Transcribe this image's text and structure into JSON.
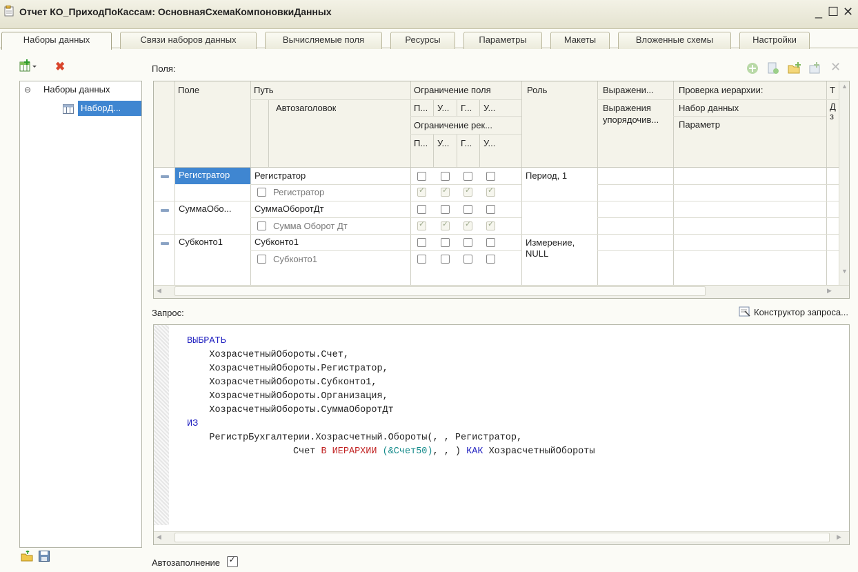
{
  "window": {
    "title": "Отчет КО_ПриходПоКассам: ОсновнаяСхемаКомпоновкиДанных",
    "minimize": "_",
    "maximize": "☐",
    "close": "✕"
  },
  "tabs": [
    {
      "label": "Наборы данных"
    },
    {
      "label": "Связи наборов данных"
    },
    {
      "label": "Вычисляемые поля"
    },
    {
      "label": "Ресурсы"
    },
    {
      "label": "Параметры"
    },
    {
      "label": "Макеты"
    },
    {
      "label": "Вложенные схемы"
    },
    {
      "label": "Настройки"
    }
  ],
  "tree": {
    "root": "Наборы данных",
    "child": "НаборД..."
  },
  "fields": {
    "label": "Поля:",
    "headers": {
      "field": "Поле",
      "path": "Путь",
      "autotitle": "Автозаголовок",
      "field_restriction": "Ограничение поля",
      "req_restriction": "Ограничение рек...",
      "sub": [
        "П...",
        "У...",
        "Г...",
        "У..."
      ],
      "role": "Роль",
      "expression": "Выражени...",
      "order_expr": "Выражения упорядочив...",
      "hierarchy": "Проверка иерархии:",
      "dataset": "Набор данных",
      "parameter": "Параметр",
      "extra": "Т",
      "extra2": "Д з"
    },
    "rows": [
      {
        "field": "Регистратор",
        "path": "Регистратор",
        "title": "Регистратор",
        "role": "Период, 1",
        "selected": true
      },
      {
        "field": "СуммаОбо...",
        "path": "СуммаОборотДт",
        "title": "Сумма Оборот Дт",
        "role": ""
      },
      {
        "field": "Субконто1",
        "path": "Субконто1",
        "title": "Субконто1",
        "role": "Измерение, NULL"
      }
    ]
  },
  "query": {
    "label": "Запрос:",
    "constructor": "Конструктор запроса...",
    "select_kw": "ВЫБРАТЬ",
    "fields": [
      "ХозрасчетныйОбороты.Счет",
      "ХозрасчетныйОбороты.Регистратор",
      "ХозрасчетныйОбороты.Субконто1",
      "ХозрасчетныйОбороты.Организация",
      "ХозрасчетныйОбороты.СуммаОборотДт"
    ],
    "from_kw": "ИЗ",
    "source": "РегистрБухгалтерии.Хозрасчетный.Обороты",
    "source_args": "(, , Регистратор,",
    "cond_prefix": "Счет",
    "in_kw": "В",
    "hier_kw": "ИЕРАРХИИ",
    "param": "(&Счет50)",
    "tail_args": ", , )",
    "as_kw": "КАК",
    "alias": "ХозрасчетныйОбороты"
  },
  "autofill": {
    "label": "Автозаполнение",
    "checked": true
  }
}
